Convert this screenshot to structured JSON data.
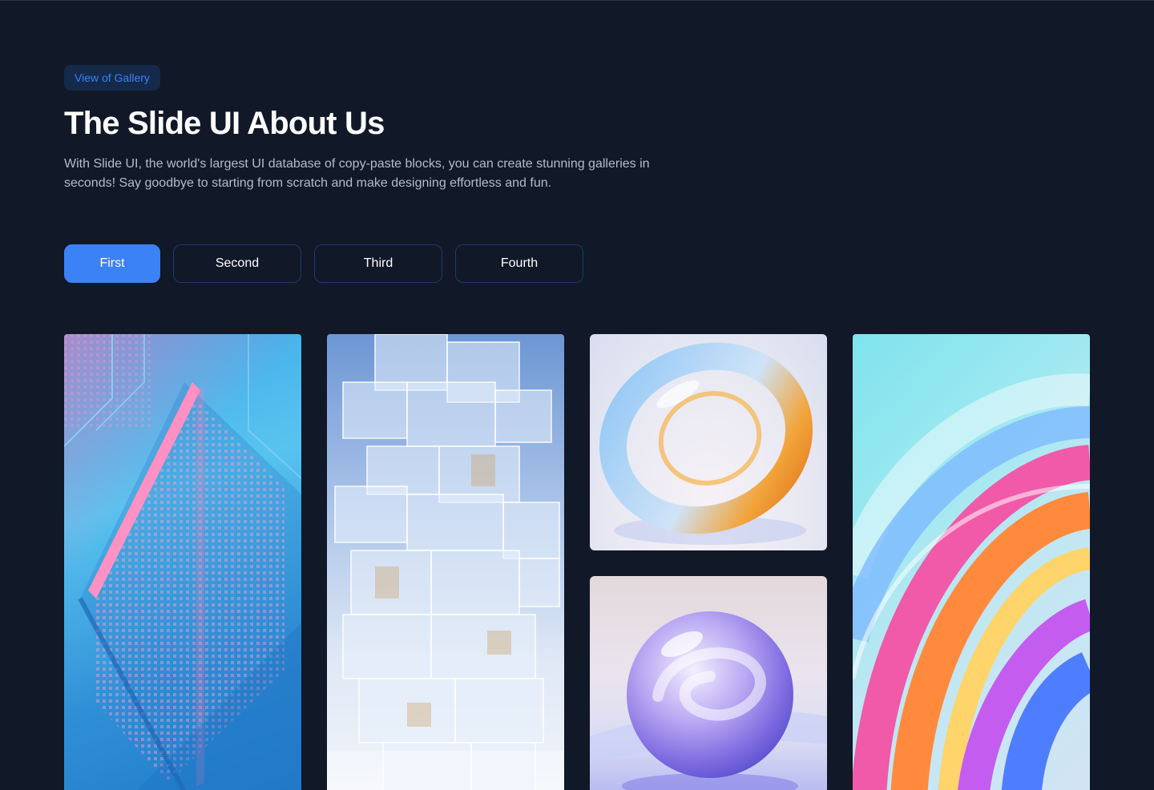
{
  "header": {
    "badge": "View of Gallery",
    "title": "The Slide UI About Us",
    "description": "With Slide UI, the world's largest UI database of copy-paste blocks, you can create stunning galleries in seconds! Say goodbye to starting from scratch and make designing effortless and fun."
  },
  "tabs": [
    {
      "label": "First",
      "active": true
    },
    {
      "label": "Second",
      "active": false
    },
    {
      "label": "Third",
      "active": false
    },
    {
      "label": "Fourth",
      "active": false
    }
  ],
  "gallery": {
    "images": [
      {
        "subject": "abstract circuit chip artwork"
      },
      {
        "subject": "stacked glass cubes tower"
      },
      {
        "subject": "glass ring sculpture"
      },
      {
        "subject": "glass sphere sculpture"
      },
      {
        "subject": "colorful glass swirl"
      }
    ]
  },
  "colors": {
    "background": "#111827",
    "accent": "#3b82f6",
    "badge_bg": "#15294a",
    "tab_border": "#1e3a70",
    "text_primary": "#ffffff",
    "text_secondary": "#b4bcc8"
  }
}
